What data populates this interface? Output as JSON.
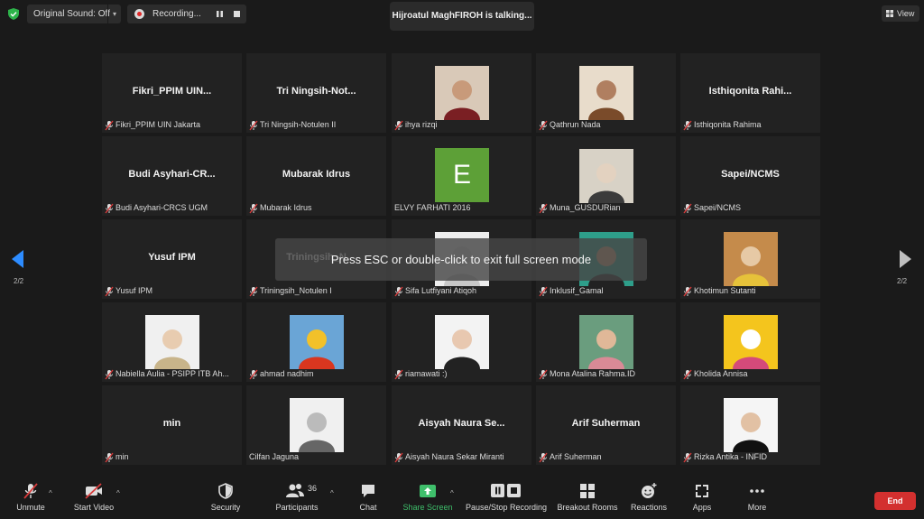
{
  "top": {
    "original_sound": "Original Sound: Off",
    "recording": "Recording...",
    "talking": "Hijroatul MaghFIROH is talking...",
    "view": "View"
  },
  "overlay": {
    "esc_message": "Press ESC or double-click to exit full screen mode"
  },
  "pagination": {
    "left": "2/2",
    "right": "2/2"
  },
  "tiles": [
    {
      "name": "Fikri_PPIM  UIN...",
      "label": "Fikri_PPIM UIN Jakarta",
      "muted": true
    },
    {
      "name": "Tri  Ningsih-Not...",
      "label": "Tri Ningsih-Notulen II",
      "muted": true
    },
    {
      "name": "",
      "label": "ihya rizqi",
      "muted": true
    },
    {
      "name": "",
      "label": "Qathrun Nada",
      "muted": true
    },
    {
      "name": "Isthiqonita  Rahi...",
      "label": "Isthiqonita Rahima",
      "muted": true
    },
    {
      "name": "Budi  Asyhari-CR...",
      "label": "Budi Asyhari-CRCS UGM",
      "muted": true
    },
    {
      "name": "Mubarak Idrus",
      "label": "Mubarak Idrus",
      "muted": true
    },
    {
      "name": "",
      "label": "ELVY FARHATI 2016",
      "muted": false,
      "avatar_letter": "E"
    },
    {
      "name": "",
      "label": "Muna_GUSDURian",
      "muted": true
    },
    {
      "name": "Sapei/NCMS",
      "label": "Sapei/NCMS",
      "muted": true
    },
    {
      "name": "Yusuf IPM",
      "label": "Yusuf IPM",
      "muted": true
    },
    {
      "name": "Triningsih_N",
      "label": "Triningsih_Notulen I",
      "muted": true
    },
    {
      "name": "",
      "label": "Sifa Lutfiyani Atiqoh",
      "muted": true
    },
    {
      "name": "",
      "label": "Inklusif_Gamal",
      "muted": true
    },
    {
      "name": "",
      "label": "Khotimun Sutanti",
      "muted": true
    },
    {
      "name": "",
      "label": "Nabiella Aulia - PSIPP ITB Ah...",
      "muted": true
    },
    {
      "name": "",
      "label": "ahmad nadhim",
      "muted": true
    },
    {
      "name": "",
      "label": "riamawati :)",
      "muted": true
    },
    {
      "name": "",
      "label": "Mona Atalina Rahma.ID",
      "muted": true
    },
    {
      "name": "",
      "label": "Kholida Annisa",
      "muted": true
    },
    {
      "name": "min",
      "label": "min",
      "muted": true
    },
    {
      "name": "",
      "label": "Cilfan Jaguna",
      "muted": false
    },
    {
      "name": "Aisyah  Naura  Se...",
      "label": "Aisyah Naura Sekar Miranti",
      "muted": true
    },
    {
      "name": "Arif  Suherman",
      "label": "Arif  Suherman",
      "muted": true
    },
    {
      "name": "",
      "label": "Rizka Antika - INFID",
      "muted": true
    }
  ],
  "toolbar": {
    "unmute": "Unmute",
    "start_video": "Start Video",
    "security": "Security",
    "participants": "Participants",
    "participants_count": "36",
    "chat": "Chat",
    "share_screen": "Share Screen",
    "recording": "Pause/Stop Recording",
    "breakout": "Breakout Rooms",
    "reactions": "Reactions",
    "apps": "Apps",
    "more": "More",
    "end": "End"
  },
  "colors": {
    "share_green": "#3fbf6b",
    "end_red": "#d3302f",
    "mute_red": "#d83b3b",
    "elvy_avatar": "#5da037"
  }
}
